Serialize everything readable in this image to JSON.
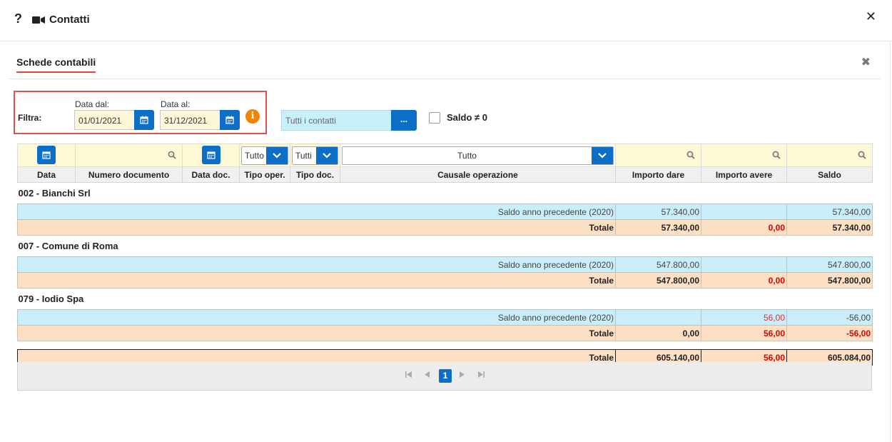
{
  "window": {
    "help_glyph": "?",
    "title": "Contatti",
    "close_glyph": "✕"
  },
  "panel": {
    "title": "Schede contabili",
    "close_glyph": "✖"
  },
  "filter": {
    "label": "Filtra:",
    "date_from_label": "Data dal:",
    "date_from_value": "01/01/2021",
    "date_to_label": "Data al:",
    "date_to_value": "31/12/2021",
    "info_glyph": "i",
    "contacts_value": "Tutti i contatti",
    "contacts_button": "...",
    "saldo_label": "Saldo ≠ 0"
  },
  "filters_row": {
    "tipo_oper": "Tutto",
    "tipo_doc": "Tutti",
    "causale": "Tutto"
  },
  "columns": [
    "Data",
    "Numero documento",
    "Data doc.",
    "Tipo oper.",
    "Tipo doc.",
    "Causale operazione",
    "Importo dare",
    "Importo avere",
    "Saldo"
  ],
  "groups": [
    {
      "name": "002 - Bianchi Srl",
      "saldo_row": {
        "causale": "Saldo anno precedente (2020)",
        "dare": "57.340,00",
        "avere": "",
        "saldo": "57.340,00"
      },
      "totale_row": {
        "label": "Totale",
        "dare": "57.340,00",
        "avere": "0,00",
        "saldo": "57.340,00"
      }
    },
    {
      "name": "007 - Comune di Roma",
      "saldo_row": {
        "causale": "Saldo anno precedente (2020)",
        "dare": "547.800,00",
        "avere": "",
        "saldo": "547.800,00"
      },
      "totale_row": {
        "label": "Totale",
        "dare": "547.800,00",
        "avere": "0,00",
        "saldo": "547.800,00"
      }
    },
    {
      "name": "079 - Iodio Spa",
      "saldo_row": {
        "causale": "Saldo anno precedente (2020)",
        "dare": "",
        "avere": "56,00",
        "saldo": "-56,00"
      },
      "totale_row": {
        "label": "Totale",
        "dare": "0,00",
        "avere": "56,00",
        "saldo": "-56,00"
      }
    }
  ],
  "grand_total": {
    "label": "Totale",
    "dare": "605.140,00",
    "avere": "56,00",
    "saldo": "605.084,00"
  },
  "pager": {
    "current_page": "1"
  },
  "colors": {
    "accent_blue": "#0d6ec7",
    "info_orange": "#f0830a",
    "negative_red": "#e00000",
    "saldo_row_bg": "#c9eef9",
    "totale_row_bg": "#fddfc4",
    "filter_bg": "#fdf8d5"
  }
}
